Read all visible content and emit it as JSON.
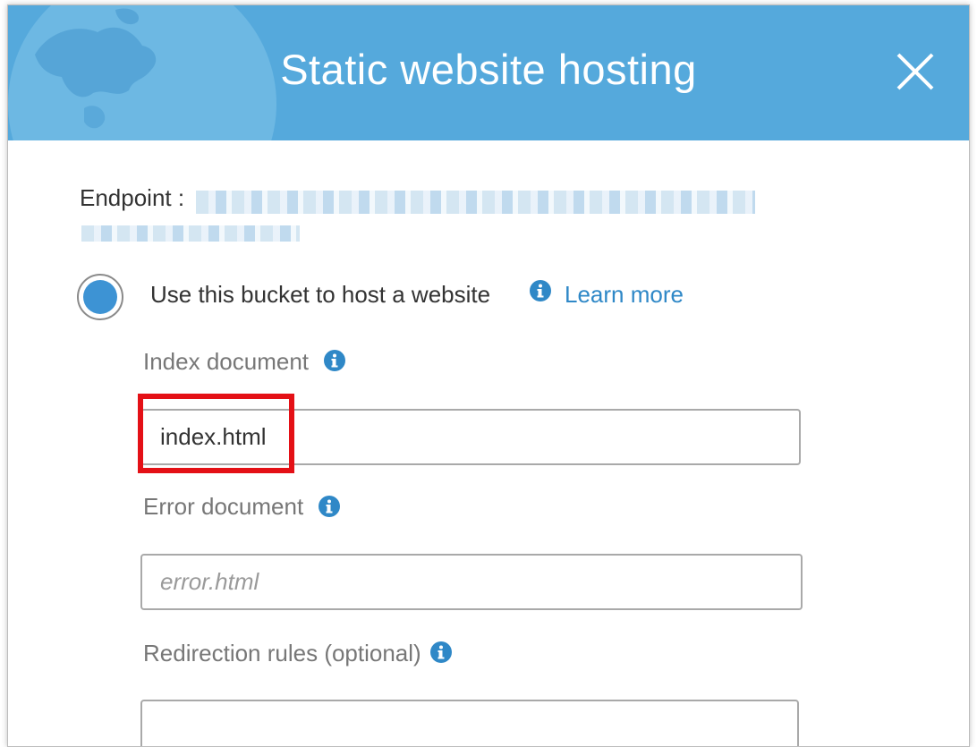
{
  "dialog": {
    "title": "Static website hosting",
    "close_icon": "close-icon"
  },
  "endpoint": {
    "label": "Endpoint :"
  },
  "hosting_option": {
    "label": "Use this bucket to host a website",
    "selected": true,
    "info_icon": "info-icon",
    "learn_more": "Learn more"
  },
  "index_document": {
    "label": "Index document",
    "value": "index.html",
    "info_icon": "info-icon"
  },
  "error_document": {
    "label": "Error document",
    "placeholder": "error.html",
    "info_icon": "info-icon"
  },
  "redirection_rules": {
    "label": "Redirection rules (optional)",
    "info_icon": "info-icon"
  },
  "colors": {
    "header": "#55a9dc",
    "link": "#2f88c7",
    "radio_selected": "#3d93d4",
    "highlight": "#e41016"
  }
}
